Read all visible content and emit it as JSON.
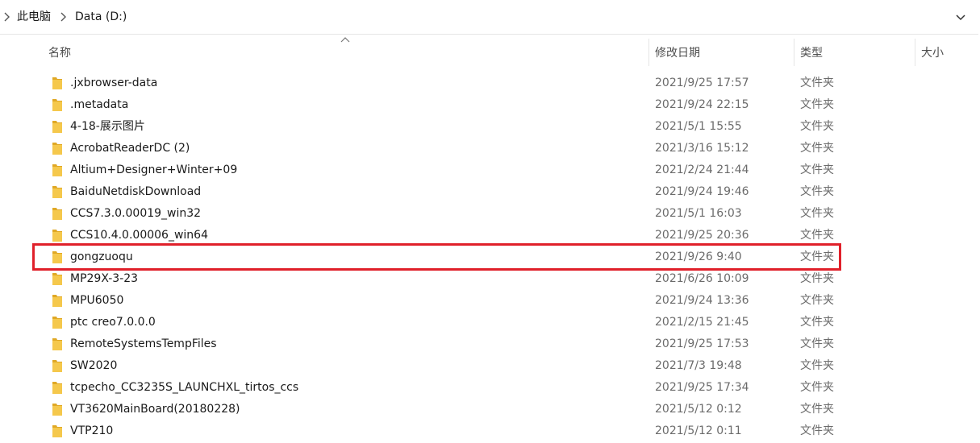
{
  "breadcrumb": [
    {
      "label": "此电脑"
    },
    {
      "label": "Data (D:)"
    }
  ],
  "columns": {
    "name": "名称",
    "date": "修改日期",
    "type": "类型",
    "size": "大小"
  },
  "files": [
    {
      "name": ".jxbrowser-data",
      "date": "2021/9/25 17:57",
      "type": "文件夹"
    },
    {
      "name": ".metadata",
      "date": "2021/9/24 22:15",
      "type": "文件夹"
    },
    {
      "name": "4-18-展示图片",
      "date": "2021/5/1 15:55",
      "type": "文件夹"
    },
    {
      "name": "AcrobatReaderDC (2)",
      "date": "2021/3/16 15:12",
      "type": "文件夹"
    },
    {
      "name": "Altium+Designer+Winter+09",
      "date": "2021/2/24 21:44",
      "type": "文件夹"
    },
    {
      "name": "BaiduNetdiskDownload",
      "date": "2021/9/24 19:46",
      "type": "文件夹"
    },
    {
      "name": "CCS7.3.0.00019_win32",
      "date": "2021/5/1 16:03",
      "type": "文件夹"
    },
    {
      "name": "CCS10.4.0.00006_win64",
      "date": "2021/9/25 20:36",
      "type": "文件夹"
    },
    {
      "name": "gongzuoqu",
      "date": "2021/9/26 9:40",
      "type": "文件夹",
      "highlighted": true
    },
    {
      "name": "MP29X-3-23",
      "date": "2021/6/26 10:09",
      "type": "文件夹"
    },
    {
      "name": "MPU6050",
      "date": "2021/9/24 13:36",
      "type": "文件夹"
    },
    {
      "name": "ptc creo7.0.0.0",
      "date": "2021/2/15 21:45",
      "type": "文件夹"
    },
    {
      "name": "RemoteSystemsTempFiles",
      "date": "2021/9/25 17:53",
      "type": "文件夹"
    },
    {
      "name": "SW2020",
      "date": "2021/7/3 19:48",
      "type": "文件夹"
    },
    {
      "name": "tcpecho_CC3235S_LAUNCHXL_tirtos_ccs",
      "date": "2021/9/25 17:34",
      "type": "文件夹"
    },
    {
      "name": "VT3620MainBoard(20180228)",
      "date": "2021/5/12 0:12",
      "type": "文件夹"
    },
    {
      "name": "VTP210",
      "date": "2021/5/12 0:11",
      "type": "文件夹"
    }
  ],
  "colors": {
    "highlight_border": "#e0202a",
    "folder_yellow": "#f5c84c",
    "folder_dark": "#e0a825"
  },
  "icons": {
    "breadcrumb_separator": "chevron-right-icon",
    "address_dropdown": "chevron-down-icon",
    "sort_indicator": "sort-up-icon",
    "file_icon": "folder-icon"
  }
}
